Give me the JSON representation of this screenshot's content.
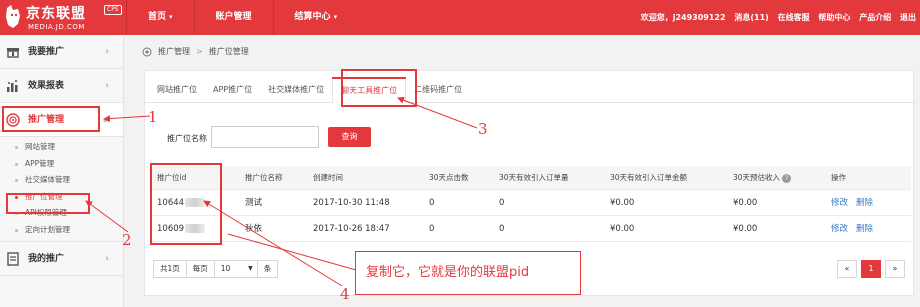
{
  "header": {
    "logo_text": "京东联盟",
    "logo_badge": "CPS",
    "logo_domain": "MEDIA.JD.COM",
    "nav": [
      {
        "label": "首页",
        "has_caret": true
      },
      {
        "label": "账户管理",
        "has_caret": false
      },
      {
        "label": "结算中心",
        "has_caret": true
      }
    ],
    "right": {
      "welcome": "欢迎您，j249309122",
      "messages": "消息(11)",
      "online_service": "在线客服",
      "help_center": "帮助中心",
      "product_intro": "产品介绍",
      "more": "退出"
    }
  },
  "sidebar": {
    "groups": [
      {
        "label": "我要推广",
        "icon": "cart-icon"
      },
      {
        "label": "效果报表",
        "icon": "bar-chart-icon"
      },
      {
        "label": "推广管理",
        "icon": "target-icon",
        "active": true
      },
      {
        "label": "我的推广",
        "icon": "list-icon"
      }
    ],
    "sub_items": [
      {
        "label": "网站管理"
      },
      {
        "label": "APP管理"
      },
      {
        "label": "社交媒体管理"
      },
      {
        "label": "推广位管理",
        "active": true
      },
      {
        "label": "API权限管理"
      },
      {
        "label": "定向计划管理"
      }
    ]
  },
  "breadcrumb": {
    "root": "推广管理",
    "current": "推广位管理"
  },
  "tabs": [
    {
      "label": "网站推广位"
    },
    {
      "label": "APP推广位"
    },
    {
      "label": "社交媒体推广位"
    },
    {
      "label": "聊天工具推广位",
      "active": true
    },
    {
      "label": "二维码推广位"
    }
  ],
  "search": {
    "label": "推广位名称",
    "value": "",
    "button": "查询"
  },
  "table": {
    "headers": [
      "推广位id",
      "推广位名称",
      "创建时间",
      "30天点击数",
      "30天有效引入订单量",
      "30天有效引入订单金额",
      "30天预估收入",
      "操作"
    ],
    "rows": [
      {
        "id": "10644",
        "name": "测试",
        "created": "2017-10-30 11:48",
        "clicks": "0",
        "orders": "0",
        "amount": "¥0.00",
        "income": "¥0.00",
        "edit": "修改",
        "delete": "删除"
      },
      {
        "id": "10609",
        "name": "秋依",
        "created": "2017-10-26 18:47",
        "clicks": "0",
        "orders": "0",
        "amount": "¥0.00",
        "income": "¥0.00",
        "edit": "修改",
        "delete": "删除"
      }
    ]
  },
  "pager": {
    "total": "共1页",
    "per_page": "每页",
    "page_size": "10",
    "unit": "条"
  },
  "pagination": {
    "prev": "«",
    "current": "1",
    "next": "»"
  },
  "annotations": {
    "numbers": [
      "1",
      "2",
      "3",
      "4"
    ],
    "callout": "复制它，它就是你的联盟pid"
  },
  "colors": {
    "brand_red": "#e4393c",
    "link_blue": "#3a78c3"
  }
}
